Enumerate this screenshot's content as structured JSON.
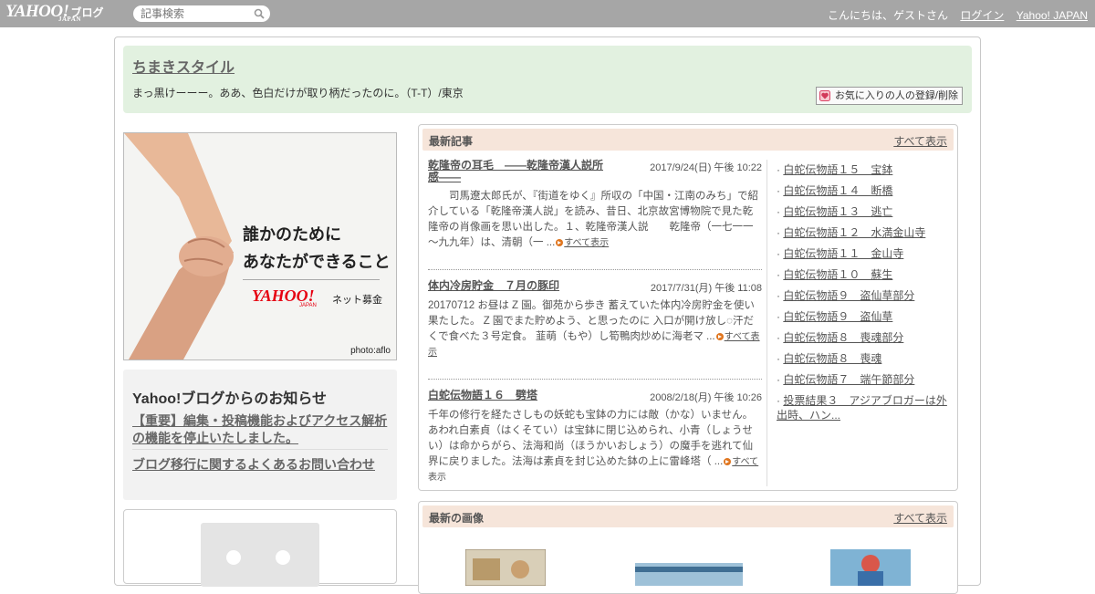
{
  "topbar": {
    "logo_main": "YAHOO!",
    "logo_sub": "JAPAN",
    "logo_blog": "ブログ",
    "search_placeholder": "記事検索",
    "greeting": "こんにちは、ゲストさん",
    "login": "ログイン",
    "yahoo_japan": "Yahoo! JAPAN"
  },
  "blog": {
    "title": "ちまきスタイル",
    "description": "まっ黒けーーー。ああ、色白だけが取り柄だったのに。（T-T）/東京",
    "fav_button": "お気に入りの人の登録/削除"
  },
  "banner": {
    "line1": "誰かのために",
    "line2": "あなたができること",
    "logo": "YAHOO!",
    "logo_sub": "JAPAN",
    "service": "ネット募金",
    "credit": "photo:aflo"
  },
  "notice": {
    "title": "Yahoo!ブログからのお知らせ",
    "item1": "【重要】編集・投稿機能およびアクセス解析の機能を停止いたしました。",
    "item2": "ブログ移行に関するよくあるお問い合わせ"
  },
  "latest_posts": {
    "heading": "最新記事",
    "see_all": "すべて表示",
    "posts": [
      {
        "title": "乾隆帝の耳毛　――乾隆帝漢人説所感――",
        "date": "2017/9/24(日) 午後 10:22",
        "body": "　　司馬遼太郎氏が、『街道をゆく』所収の「中国・江南のみち」で紹介している「乾隆帝漢人説」を読み、昔日、北京故宮博物院で見た乾隆帝の肖像画を思い出した。１、乾隆帝漢人説　　乾隆帝（一七一一～九九年）は、清朝（一 ...",
        "more": "すべて表示"
      },
      {
        "title": "体内冷房貯金　７月の豚印",
        "date": "2017/7/31(月) 午後 11:08",
        "body": "20170712 お昼は Z 園。御苑から歩き 蓄えていた体内冷房貯金を使い果たした。 Z 園でまた貯めよう、と思ったのに 入口が開け放し◌汗だくで食べた３号定食。 韮萌（もや）し筍鴨肉炒めに海老マ ...",
        "more": "すべて表示"
      },
      {
        "title": "白蛇伝物語１６　劈塔",
        "date": "2008/2/18(月) 午後 10:26",
        "body": "千年の修行を経たさしもの妖蛇も宝鉢の力には敵（かな）いません。あわれ白素貞（はくそてい）は宝鉢に閉じ込められ、小青（しょうせい）は命からがら、法海和尚（ほうかいおしょう）の魔手を逃れて仙界に戻りました。法海は素貞を封じ込めた鉢の上に雷峰塔（ ...",
        "more": "すべて表示"
      }
    ],
    "side_links": [
      "白蛇伝物語１５　宝鉢",
      "白蛇伝物語１４　断橋",
      "白蛇伝物語１３　逃亡",
      "白蛇伝物語１２　水満金山寺",
      "白蛇伝物語１１　金山寺",
      "白蛇伝物語１０　蘇生",
      "白蛇伝物語９　盗仙草部分",
      "白蛇伝物語９　盗仙草",
      "白蛇伝物語８　喪魂部分",
      "白蛇伝物語８　喪魂",
      "白蛇伝物語７　端午節部分",
      "投票結果３　アジアブロガーは外出時、ハン..."
    ]
  },
  "latest_images": {
    "heading": "最新の画像",
    "see_all": "すべて表示"
  },
  "colors": {
    "topbar": "#a6a6a6",
    "header_bg": "#e2f1e0",
    "section_head": "#f6e5da",
    "arrow": "#e0761f"
  }
}
